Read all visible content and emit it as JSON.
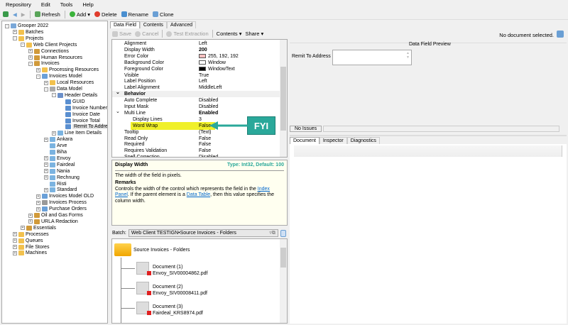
{
  "menu": [
    "Repository",
    "Edit",
    "Tools",
    "Help"
  ],
  "toolbar": {
    "refresh": "Refresh",
    "add": "Add",
    "delete": "Delete",
    "rename": "Rename",
    "clone": "Clone"
  },
  "tree": [
    {
      "label": "Grooper 2022",
      "level": 0,
      "exp": "-",
      "color": "#7aa7d8"
    },
    {
      "label": "Batches",
      "level": 1,
      "exp": "+",
      "color": "#f2c14e"
    },
    {
      "label": "Projects",
      "level": 1,
      "exp": "-",
      "color": "#f2c14e"
    },
    {
      "label": "Web Client Projects",
      "level": 2,
      "exp": "-",
      "color": "#f2c14e"
    },
    {
      "label": "Connections",
      "level": 3,
      "exp": "+",
      "color": "#d19a3a"
    },
    {
      "label": "Human Resources",
      "level": 3,
      "exp": "+",
      "color": "#d19a3a"
    },
    {
      "label": "Invoices",
      "level": 3,
      "exp": "-",
      "color": "#d19a3a"
    },
    {
      "label": "Processing Resources",
      "level": 4,
      "exp": "+",
      "color": "#f2c14e"
    },
    {
      "label": "Invoices Model",
      "level": 4,
      "exp": "-",
      "color": "#6aa0d8"
    },
    {
      "label": "Local Resources",
      "level": 5,
      "exp": "+",
      "color": "#f2c14e"
    },
    {
      "label": "Data Model",
      "level": 5,
      "exp": "-",
      "color": "#aaa"
    },
    {
      "label": "Header Details",
      "level": 6,
      "exp": "-",
      "color": "#6b8fc9"
    },
    {
      "label": "GUID",
      "level": 7,
      "exp": "",
      "color": "#5a8fd0"
    },
    {
      "label": "Invoice Number",
      "level": 7,
      "exp": "",
      "color": "#5a8fd0"
    },
    {
      "label": "Invoice Date",
      "level": 7,
      "exp": "",
      "color": "#5a8fd0"
    },
    {
      "label": "Invoice Total",
      "level": 7,
      "exp": "",
      "color": "#5a8fd0"
    },
    {
      "label": "Remit To Address",
      "level": 7,
      "exp": "",
      "color": "#5a8fd0",
      "selected": true
    },
    {
      "label": "Line Item Details",
      "level": 6,
      "exp": "+",
      "color": "#7bb3e0"
    },
    {
      "label": "Ankara",
      "level": 5,
      "exp": "+",
      "color": "#7bb3e0"
    },
    {
      "label": "Arve",
      "level": 5,
      "exp": "",
      "color": "#7bb3e0"
    },
    {
      "label": "Biha",
      "level": 5,
      "exp": "",
      "color": "#7bb3e0"
    },
    {
      "label": "Envoy",
      "level": 5,
      "exp": "+",
      "color": "#7bb3e0"
    },
    {
      "label": "Fairdeal",
      "level": 5,
      "exp": "+",
      "color": "#7bb3e0"
    },
    {
      "label": "Nania",
      "level": 5,
      "exp": "+",
      "color": "#7bb3e0"
    },
    {
      "label": "Rechnung",
      "level": 5,
      "exp": "+",
      "color": "#7bb3e0"
    },
    {
      "label": "Risti",
      "level": 5,
      "exp": "",
      "color": "#7bb3e0"
    },
    {
      "label": "Standard",
      "level": 5,
      "exp": "+",
      "color": "#7bb3e0"
    },
    {
      "label": "Invoices Model OLD",
      "level": 4,
      "exp": "+",
      "color": "#6aa0d8"
    },
    {
      "label": "Invoices Process",
      "level": 4,
      "exp": "+",
      "color": "#999"
    },
    {
      "label": "Purchase Orders",
      "level": 4,
      "exp": "+",
      "color": "#6aa0d8"
    },
    {
      "label": "Oil and Gas Forms",
      "level": 3,
      "exp": "+",
      "color": "#d19a3a"
    },
    {
      "label": "URLA Redaction",
      "level": 3,
      "exp": "+",
      "color": "#d19a3a"
    },
    {
      "label": "Essentials",
      "level": 2,
      "exp": "+",
      "color": "#d19a3a"
    },
    {
      "label": "Processes",
      "level": 1,
      "exp": "+",
      "color": "#f2c14e"
    },
    {
      "label": "Queues",
      "level": 1,
      "exp": "+",
      "color": "#f2c14e"
    },
    {
      "label": "File Stores",
      "level": 1,
      "exp": "+",
      "color": "#f2c14e"
    },
    {
      "label": "Machines",
      "level": 1,
      "exp": "+",
      "color": "#f2c14e"
    }
  ],
  "mid": {
    "tabs": [
      "Data Field",
      "Contents",
      "Advanced"
    ],
    "save": "Save",
    "cancel": "Cancel",
    "test": "Test Extraction",
    "contents": "Contents",
    "share": "Share"
  },
  "properties": [
    {
      "name": "Alignment",
      "value": "Left"
    },
    {
      "name": "Display Width",
      "value": "200",
      "bold": true
    },
    {
      "name": "Error Color",
      "value": "255, 192, 192",
      "swatch": "#ffc0c0"
    },
    {
      "name": "Background Color",
      "value": "Window",
      "swatch": "#ffffff"
    },
    {
      "name": "Foreground Color",
      "value": "WindowText",
      "swatch": "#000000"
    },
    {
      "name": "Visible",
      "value": "True"
    },
    {
      "name": "Label Position",
      "value": "Left"
    },
    {
      "name": "Label Alignment",
      "value": "MiddleLeft"
    },
    {
      "name": "Behavior",
      "value": "",
      "category": true
    },
    {
      "name": "Auto Complete",
      "value": "Disabled"
    },
    {
      "name": "Input Mask",
      "value": "Disabled"
    },
    {
      "name": "Multi Line",
      "value": "Enabled",
      "bold": true,
      "expanded": true
    },
    {
      "name": "Display Lines",
      "value": "3",
      "sub": true
    },
    {
      "name": "Word Wrap",
      "value": "False",
      "sub": true,
      "highlight": true
    },
    {
      "name": "Tooltip",
      "value": "(Text)"
    },
    {
      "name": "Read Only",
      "value": "False"
    },
    {
      "name": "Required",
      "value": "False"
    },
    {
      "name": "Requires Validation",
      "value": "False"
    },
    {
      "name": "Spell Correction",
      "value": "Disabled"
    }
  ],
  "annotation": "FYI",
  "help": {
    "title": "Display Width",
    "type": "Type: Int32, Default: 100",
    "desc": "The width of the field in pixels.",
    "remarks": "Remarks",
    "r1": "Controls the width of the control which represents the field in the ",
    "link1": "Index Panel",
    "r2": ". If the parent element is a ",
    "link2": "Data Table",
    "r3": ", then this value specifies the column width."
  },
  "batch": {
    "label": "Batch:",
    "value": "Web Client TESTIGN•Source Invoices - Folders",
    "folder": "Source Invoices - Folders",
    "docs": [
      {
        "name": "Document (1)",
        "file": "Envoy_SIV00004862.pdf"
      },
      {
        "name": "Document (2)",
        "file": "Envoy_SIV00008411.pdf"
      },
      {
        "name": "Document (3)",
        "file": "Fairdeal_KRS8974.pdf"
      }
    ]
  },
  "right": {
    "status": "No document selected.",
    "preview_title": "Data Field Preview",
    "field_label": "Remit To Address",
    "issues": "No Issues",
    "tabs": [
      "Document",
      "Inspector",
      "Diagnostics"
    ]
  }
}
